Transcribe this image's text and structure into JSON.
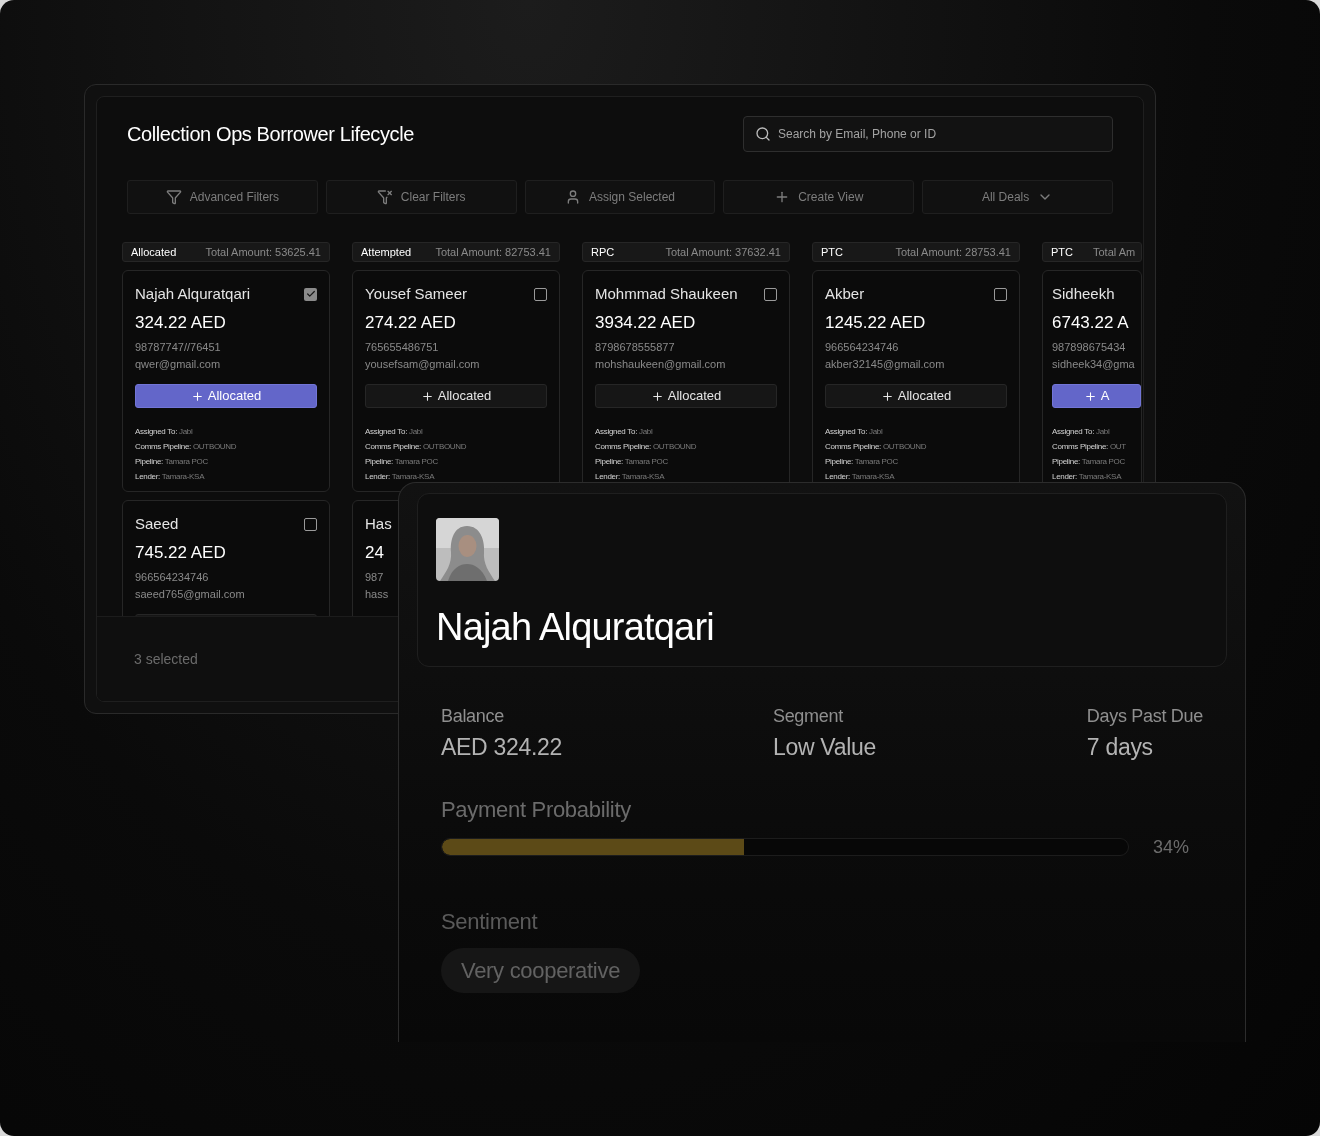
{
  "board": {
    "title": "Collection Ops Borrower Lifecycle",
    "search": {
      "placeholder": "Search by Email, Phone or ID"
    },
    "toolbar": [
      {
        "kind": "filter",
        "label": "Advanced Filters"
      },
      {
        "kind": "clear",
        "label": "Clear Filters"
      },
      {
        "kind": "assign",
        "label": "Assign Selected"
      },
      {
        "kind": "create",
        "label": "Create View"
      },
      {
        "kind": "dropdown",
        "label": "All Deals"
      }
    ],
    "columns": [
      {
        "stage": "Allocated",
        "total": "Total Amount: 53625.41",
        "cards": [
          {
            "name": "Najah Alquratqari",
            "amount": "324.22 AED",
            "phone": "98787747//76451",
            "email": "qwer@gmail.com",
            "checkbox": {
              "checked": true
            },
            "button": {
              "label": "Allocated",
              "selected": true
            },
            "details": [
              {
                "label": "Assigned To:",
                "value": "Jabl"
              },
              {
                "label": "Comms Pipeline:",
                "value": "OUTBOUND"
              },
              {
                "label": "Pipeline:",
                "value": "Tamara POC"
              },
              {
                "label": "Lender:",
                "value": "Tamara-KSA"
              }
            ]
          },
          {
            "name": "Saeed",
            "amount": "745.22 AED",
            "phone": "966564234746",
            "email": "saeed765@gmail.com",
            "checkbox": {
              "checked": false
            },
            "button": {
              "selected": false
            }
          }
        ]
      },
      {
        "stage": "Attempted",
        "total": "Total Amount: 82753.41",
        "cards": [
          {
            "name": "Yousef Sameer",
            "amount": "274.22 AED",
            "phone": "765655486751",
            "email": "yousefsam@gmail.com",
            "checkbox": {
              "checked": false
            },
            "button": {
              "label": "Allocated",
              "selected": false
            },
            "details": [
              {
                "label": "Assigned To:",
                "value": "Jabl"
              },
              {
                "label": "Comms Pipeline:",
                "value": "OUTBOUND"
              },
              {
                "label": "Pipeline:",
                "value": "Tamara POC"
              },
              {
                "label": "Lender:",
                "value": "Tamara-KSA"
              }
            ]
          },
          {
            "name": "Has",
            "amount": "24",
            "phone": "987",
            "email": "hass"
          }
        ]
      },
      {
        "stage": "RPC",
        "total": "Total Amount: 37632.41",
        "cards": [
          {
            "name": "Mohmmad Shaukeen",
            "amount": "3934.22 AED",
            "phone": "8798678555877",
            "email": "mohshaukeen@gmail.com",
            "checkbox": {
              "checked": false
            },
            "button": {
              "label": "Allocated",
              "selected": false
            },
            "details": [
              {
                "label": "Assigned To:",
                "value": "Jabl"
              },
              {
                "label": "Comms Pipeline:",
                "value": "OUTBOUND"
              },
              {
                "label": "Pipeline:",
                "value": "Tamara POC"
              },
              {
                "label": "Lender:",
                "value": "Tamara-KSA"
              }
            ]
          }
        ]
      },
      {
        "stage": "PTC",
        "total": "Total Amount: 28753.41",
        "cards": [
          {
            "name": "Akber",
            "amount": "1245.22 AED",
            "phone": "966564234746",
            "email": "akber32145@gmail.com",
            "checkbox": {
              "checked": false
            },
            "button": {
              "label": "Allocated",
              "selected": false
            },
            "details": [
              {
                "label": "Assigned To:",
                "value": "Jabl"
              },
              {
                "label": "Comms Pipeline:",
                "value": "OUTBOUND"
              },
              {
                "label": "Pipeline:",
                "value": "Tamara POC"
              },
              {
                "label": "Lender:",
                "value": "Tamara-KSA"
              }
            ]
          }
        ]
      },
      {
        "stage": "PTC",
        "total": "Total Am",
        "cards": [
          {
            "name": "Sidheekh",
            "amount": "6743.22 A",
            "phone": "987898675434",
            "email": "sidheek34@gma",
            "button": {
              "label": "A",
              "selected": true
            },
            "details": [
              {
                "label": "Assigned To:",
                "value": "Jabl"
              },
              {
                "label": "Comms Pipeline:",
                "value": "OUT"
              },
              {
                "label": "Pipeline:",
                "value": "Tamara POC"
              },
              {
                "label": "Lender:",
                "value": "Tamara-KSA"
              }
            ]
          }
        ]
      }
    ],
    "footer": "3 selected"
  },
  "detail": {
    "name": "Najah Alquratqari",
    "stats": [
      {
        "label": "Balance",
        "value": "AED 324.22"
      },
      {
        "label": "Segment",
        "value": "Low Value"
      },
      {
        "label": "Days Past Due",
        "value": "7 days"
      }
    ],
    "probability": {
      "label": "Payment Probability",
      "level": 0.44,
      "reading": "34%"
    },
    "sentiment": {
      "label": "Sentiment",
      "value": "Very cooperative"
    }
  }
}
